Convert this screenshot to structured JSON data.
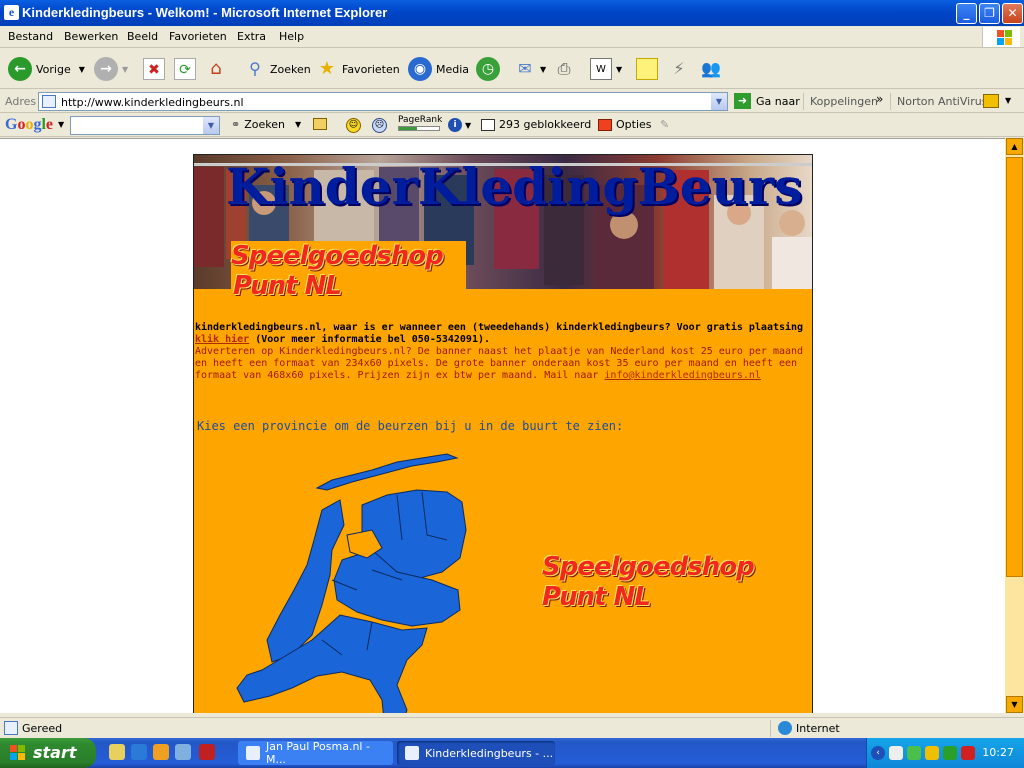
{
  "window": {
    "title": "Kinderkledingbeurs - Welkom! - Microsoft Internet Explorer",
    "buttons": {
      "minimize": "_",
      "maximize": "❐",
      "close": "✕"
    }
  },
  "menu": [
    "Bestand",
    "Bewerken",
    "Beeld",
    "Favorieten",
    "Extra",
    "Help"
  ],
  "toolbar": {
    "back": "Vorige",
    "search": "Zoeken",
    "favorites": "Favorieten",
    "media": "Media"
  },
  "address": {
    "label": "Adres",
    "url": "http://www.kinderkledingbeurs.nl",
    "go": "Ga naar",
    "links": "Koppelingen",
    "norton": "Norton AntiVirus"
  },
  "google": {
    "logo": "Google",
    "search": "Zoeken",
    "pagerank": "PageRank",
    "pagerank_level": 0.45,
    "blocked": "293 geblokkeerd",
    "options": "Opties"
  },
  "page": {
    "banner_title": "KinderKledingBeurs",
    "shop_line1": "Speelgoedshop",
    "shop_line2": "Punt NL",
    "intro_bold": "kinderkledingbeurs.nl, waar is er wanneer een (tweedehands) kinderkledingbeurs? Voor gratis plaatsing",
    "intro_link": "klik hier",
    "intro_phone": "(Voor meer informatie bel 050-5342091).",
    "ad_text": "Adverteren op Kinderkledingbeurs.nl? De banner naast het plaatje van Nederland kost 25 euro per maand en heeft een formaat van 234x60 pixels. De grote banner onderaan kost 35 euro per maand en heeft een formaat van 468x60 pixels. Prijzen zijn ex btw per maand. Mail naar",
    "ad_email": "info@kinderkledingbeurs.nl",
    "province_prompt": "Kies een provincie om de beurzen bij u in de buurt te zien:"
  },
  "status": {
    "text": "Gereed",
    "zone": "Internet"
  },
  "taskbar": {
    "start": "start",
    "tasks": [
      "Jan Paul Posma.nl - M...",
      "Kinderkledingbeurs - ..."
    ],
    "clock": "10:27"
  },
  "colors": {
    "page_bg": "#ffa500",
    "map_blue": "#1a66d8",
    "title_blue": "#001d9e",
    "link_red": "#b42a00"
  }
}
